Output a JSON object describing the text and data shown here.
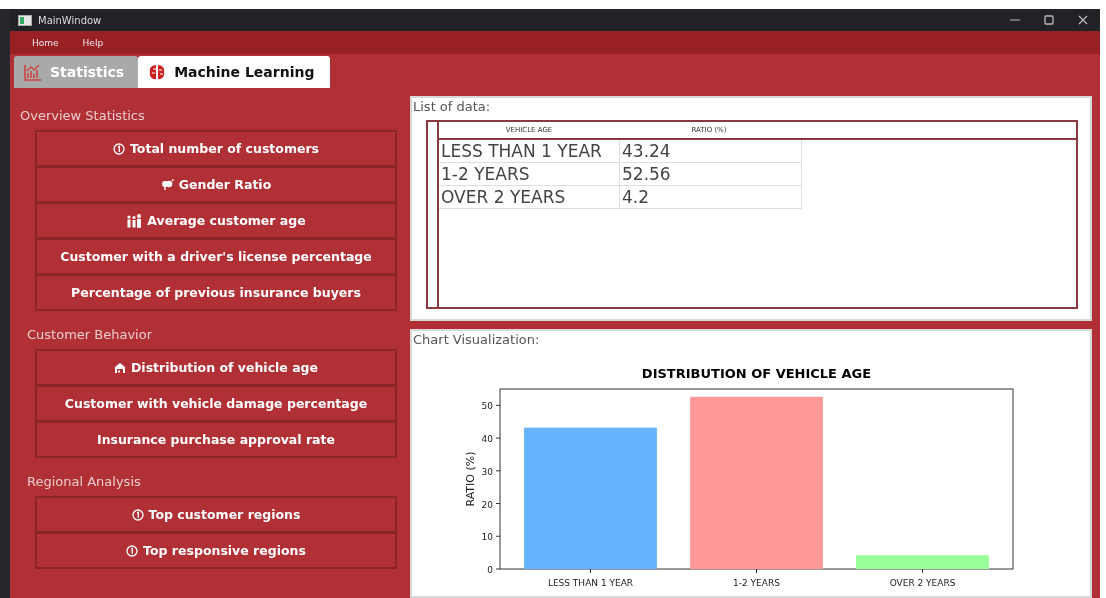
{
  "window": {
    "title": "MainWindow"
  },
  "menu": [
    "Home",
    "Help"
  ],
  "tabs": [
    {
      "label": "Statistics",
      "kind": "chart",
      "selected": false
    },
    {
      "label": "Machine Learning",
      "kind": "brain",
      "selected": true
    }
  ],
  "sections": [
    {
      "title": "Overview Statistics",
      "buttons": [
        {
          "label": "Total number of customers",
          "kind": "info"
        },
        {
          "label": "Gender Ratio",
          "kind": "gender"
        },
        {
          "label": "Average customer age",
          "kind": "people"
        },
        {
          "label": "Customer with a driver's license percentage",
          "kind": "plain"
        },
        {
          "label": "Percentage of previous insurance buyers",
          "kind": "plain"
        }
      ]
    },
    {
      "title": "Customer Behavior",
      "buttons": [
        {
          "label": "Distribution of vehicle age",
          "kind": "garage"
        },
        {
          "label": "Customer with vehicle damage percentage",
          "kind": "plain"
        },
        {
          "label": "Insurance purchase approval rate",
          "kind": "plain"
        }
      ]
    },
    {
      "title": "Regional Analysis",
      "buttons": [
        {
          "label": "Top customer regions",
          "kind": "info"
        },
        {
          "label": "Top responsive regions",
          "kind": "info"
        }
      ]
    }
  ],
  "list_panel": {
    "title": "List of data:",
    "columns": [
      "VEHICLE AGE",
      "RATIO (%)"
    ],
    "rows": [
      [
        "LESS THAN 1 YEAR",
        "43.24"
      ],
      [
        "1-2 YEARS",
        "52.56"
      ],
      [
        "OVER 2 YEARS",
        "4.2"
      ]
    ]
  },
  "chart_panel": {
    "title": "Chart Visualization:",
    "chart_data": {
      "type": "bar",
      "title": "DISTRIBUTION OF VEHICLE AGE",
      "ylabel": "RATIO (%)",
      "categories": [
        "LESS THAN 1 YEAR",
        "1-2 YEARS",
        "OVER 2 YEARS"
      ],
      "series": [
        {
          "color": "#66b3ff",
          "values": [
            43.2,
            null,
            null
          ]
        },
        {
          "color": "#ff9999",
          "values": [
            null,
            52.6,
            null
          ]
        },
        {
          "color": "#99ff99",
          "values": [
            null,
            null,
            4.2
          ]
        }
      ],
      "ylim": [
        0,
        55
      ],
      "yticks": [
        0,
        10,
        20,
        30,
        40,
        50
      ]
    }
  }
}
